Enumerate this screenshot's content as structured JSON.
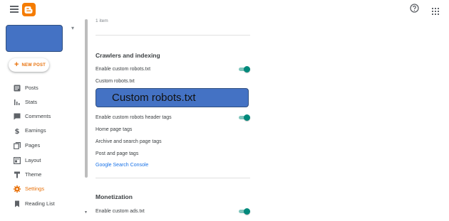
{
  "header": {
    "logo_icon": "blogger-logo-icon",
    "menu_icon": "hamburger-menu-icon",
    "help_icon": "help-circle-icon",
    "apps_icon": "apps-grid-icon",
    "brand_color": "#f57c00"
  },
  "sidebar": {
    "new_post_label": "NEW POST",
    "accent_color": "#e8710a",
    "items": [
      {
        "label": "Posts",
        "icon": "posts-icon"
      },
      {
        "label": "Stats",
        "icon": "stats-icon"
      },
      {
        "label": "Comments",
        "icon": "comments-icon"
      },
      {
        "label": "Earnings",
        "icon": "earnings-icon"
      },
      {
        "label": "Pages",
        "icon": "pages-icon"
      },
      {
        "label": "Layout",
        "icon": "layout-icon"
      },
      {
        "label": "Theme",
        "icon": "theme-icon"
      },
      {
        "label": "Settings",
        "icon": "settings-icon",
        "active": true
      },
      {
        "label": "Reading List",
        "icon": "bookmark-icon"
      }
    ]
  },
  "main": {
    "item_count": "1 item",
    "crawlers": {
      "title": "Crawlers and indexing",
      "enable_robots_label": "Enable custom robots.txt",
      "enable_robots_on": true,
      "robots_label": "Custom robots.txt",
      "robots_box_text": "Custom robots.txt",
      "enable_header_tags_label": "Enable custom robots header tags",
      "enable_header_tags_on": true,
      "home_tags_label": "Home page tags",
      "archive_tags_label": "Archive and search page tags",
      "post_tags_label": "Post and page tags",
      "search_console_link": "Google Search Console"
    },
    "monetization": {
      "title": "Monetization",
      "enable_ads_label": "Enable custom ads.txt",
      "enable_ads_on": true
    },
    "toggle_color": "#00897b",
    "link_color": "#1a73e8"
  }
}
